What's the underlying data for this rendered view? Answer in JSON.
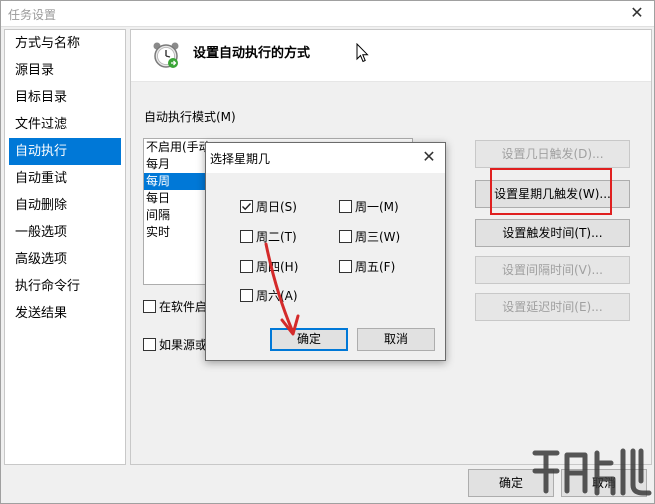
{
  "window": {
    "title": "任务设置",
    "close_glyph": "✕"
  },
  "nav": {
    "items": [
      {
        "label": "方式与名称",
        "selected": false
      },
      {
        "label": "源目录",
        "selected": false
      },
      {
        "label": "目标目录",
        "selected": false
      },
      {
        "label": "文件过滤",
        "selected": false
      },
      {
        "label": "自动执行",
        "selected": true
      },
      {
        "label": "自动重试",
        "selected": false
      },
      {
        "label": "自动删除",
        "selected": false
      },
      {
        "label": "一般选项",
        "selected": false
      },
      {
        "label": "高级选项",
        "selected": false
      },
      {
        "label": "执行命令行",
        "selected": false
      },
      {
        "label": "发送结果",
        "selected": false
      }
    ]
  },
  "panel": {
    "title": "设置自动执行的方式",
    "mode_label": "自动执行模式(M)",
    "modes": [
      {
        "label": "不启用(手动",
        "selected": false
      },
      {
        "label": "每月",
        "selected": false
      },
      {
        "label": "每周",
        "selected": true
      },
      {
        "label": "每日",
        "selected": false
      },
      {
        "label": "间隔",
        "selected": false
      },
      {
        "label": "实时",
        "selected": false
      }
    ],
    "checkbox1": {
      "label": "在软件启",
      "checked": false
    },
    "checkbox2": {
      "label": "如果源或",
      "checked": false
    },
    "buttons": {
      "set_day": "设置几日触发(D)...",
      "set_weekday": "设置星期几触发(W)...",
      "set_time": "设置触发时间(T)...",
      "set_interval": "设置间隔时间(V)...",
      "set_delay": "设置延迟时间(E)..."
    }
  },
  "footer": {
    "ok": "确定",
    "cancel": "取消"
  },
  "dialog": {
    "title": "选择星期几",
    "close_glyph": "✕",
    "days": {
      "sun": {
        "label": "周日(S)",
        "checked": true
      },
      "mon": {
        "label": "周一(M)",
        "checked": false
      },
      "tue": {
        "label": "周二(T)",
        "checked": false
      },
      "wed": {
        "label": "周三(W)",
        "checked": false
      },
      "thu": {
        "label": "周四(H)",
        "checked": false
      },
      "fri": {
        "label": "周五(F)",
        "checked": false
      },
      "sat": {
        "label": "周六(A)",
        "checked": false
      }
    },
    "ok": "确定",
    "cancel": "取消"
  },
  "colors": {
    "accent": "#0078d7",
    "highlight": "#e02020",
    "arrow": "#d42a2a"
  }
}
